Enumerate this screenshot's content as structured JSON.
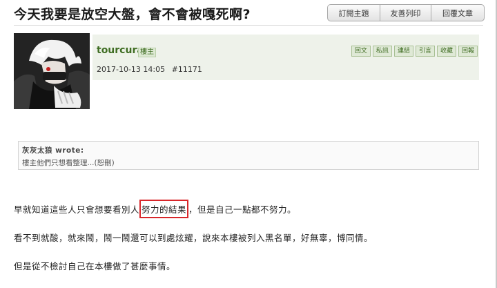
{
  "topic": {
    "title": "今天我要是放空大盤，會不會被嘎死啊?"
  },
  "actions": {
    "subscribe_label": "訂閱主題",
    "print_label": "友善列印",
    "reply_label": "回覆文章"
  },
  "post": {
    "username": "tourcura",
    "role_badge": "樓主",
    "timestamp": "2017-10-13 14:05",
    "post_number": "#11171",
    "tools": [
      {
        "label": "回文",
        "name": "reply-tool-button"
      },
      {
        "label": "私訊",
        "name": "message-tool-button"
      },
      {
        "label": "連結",
        "name": "link-tool-button"
      },
      {
        "label": "引言",
        "name": "quote-tool-button"
      },
      {
        "label": "收藏",
        "name": "favorite-tool-button"
      },
      {
        "label": "回報",
        "name": "report-tool-button"
      }
    ]
  },
  "quote": {
    "author": "灰灰太狼 wrote:",
    "text": "樓主他們只想看整理...(恕刪)"
  },
  "body": {
    "line1_before": "早就知道這些人只會想要看別人",
    "line1_highlight": "努力的結果",
    "line1_after": "，但是自己一點都不努力。",
    "line2": "看不到就酸，就來鬧，鬧一鬧還可以到處炫耀，說來本樓被列入黑名單，好無辜，博同情。",
    "line3": "但是從不檢討自己在本樓做了甚麼事情。"
  },
  "colors": {
    "username": "#3f6d23",
    "post_header_bg": "#eef2ea",
    "highlight_border": "#d8262a"
  }
}
